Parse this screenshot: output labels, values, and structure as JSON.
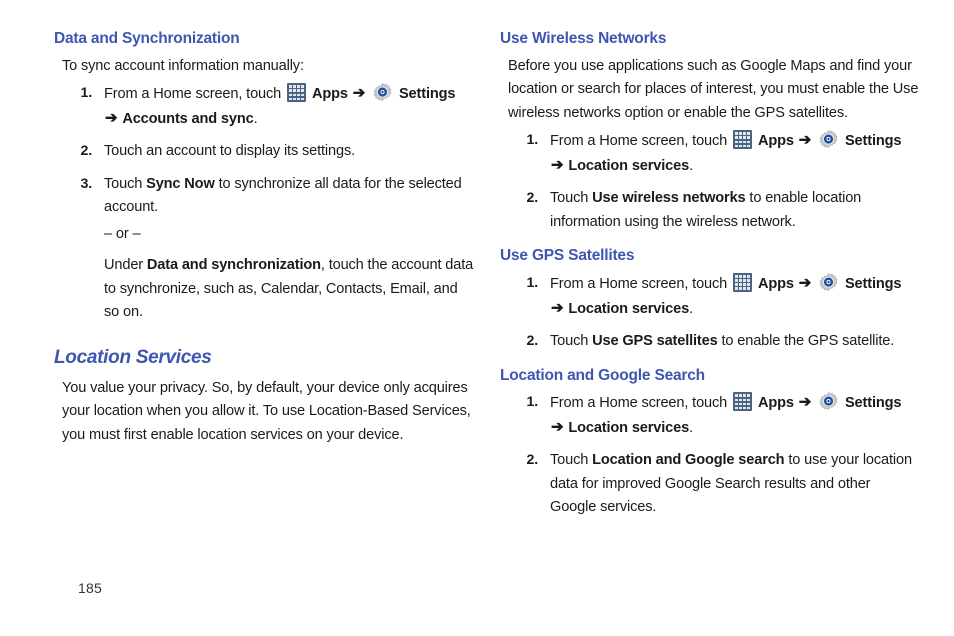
{
  "page": {
    "number": "185",
    "heading_color": "#3f56b0",
    "text_color": "#1b1b1b",
    "background_color": "#ffffff"
  },
  "icons": {
    "apps": {
      "name": "apps-grid-icon",
      "label": "Apps",
      "bg_color": "#4a6382",
      "dot_color": "#e2e8ee"
    },
    "settings": {
      "name": "settings-gear-icon",
      "label": "Settings",
      "gear_color": "#c9c9c9",
      "ring_color": "#1b4fa8"
    },
    "arrow": "➔"
  },
  "left_column": {
    "section1": {
      "heading": "Data and Synchronization",
      "intro": "To sync account information manually:",
      "steps": [
        {
          "num": "1.",
          "pre_apps": "From a Home screen, touch",
          "apps_label": "Apps",
          "settings_label": "Settings",
          "continuation": "Accounts and sync",
          "continuation_tail": "."
        },
        {
          "num": "2.",
          "text": "Touch an account to display its settings."
        },
        {
          "num": "3.",
          "lead": "Touch",
          "bold1": "Sync Now",
          "after_bold1": "to synchronize all data for the selected account.",
          "or_text": "– or –",
          "alt_lead": "Under",
          "alt_bold": "Data and synchronization",
          "alt_tail": ", touch the account data to synchronize, such as, Calendar, Contacts, Email, and so on."
        }
      ]
    },
    "section2": {
      "heading": "Location Services",
      "body": "You value your privacy. So, by default, your device only acquires your location when you allow it. To use Location-Based Services, you must first enable location services on your device."
    }
  },
  "right_column": {
    "section1": {
      "heading": "Use Wireless Networks",
      "body": "Before you use applications such as Google Maps and find your location or search for places of interest, you must enable the Use wireless networks option or enable the GPS satellites.",
      "steps": [
        {
          "num": "1.",
          "pre_apps": "From a Home screen, touch",
          "apps_label": "Apps",
          "settings_label": "Settings",
          "continuation": "Location services",
          "continuation_tail": "."
        },
        {
          "num": "2.",
          "lead": "Touch",
          "bold1": "Use wireless networks",
          "after_bold1": "to enable location information using the wireless network."
        }
      ]
    },
    "section2": {
      "heading": "Use GPS Satellites",
      "steps": [
        {
          "num": "1.",
          "pre_apps": "From a Home screen, touch",
          "apps_label": "Apps",
          "settings_label": "Settings",
          "continuation": "Location services",
          "continuation_tail": "."
        },
        {
          "num": "2.",
          "lead": "Touch",
          "bold1": "Use GPS satellites",
          "after_bold1": "to enable the GPS satellite."
        }
      ]
    },
    "section3": {
      "heading": "Location and Google Search",
      "steps": [
        {
          "num": "1.",
          "pre_apps": "From a Home screen, touch",
          "apps_label": "Apps",
          "settings_label": "Settings",
          "continuation": "Location services",
          "continuation_tail": "."
        },
        {
          "num": "2.",
          "lead": "Touch",
          "bold1": "Location and Google search",
          "after_bold1": "to use your location data for improved Google Search results and other Google services."
        }
      ]
    }
  }
}
